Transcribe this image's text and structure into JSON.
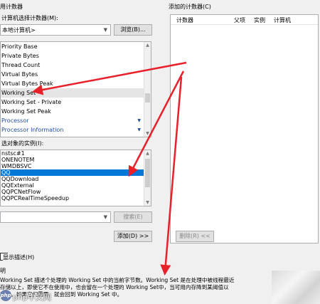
{
  "header": {
    "available_counters": "用计数器",
    "select_from_computer": "计算机选择计数器(M):",
    "added_counters": "添加的计数器(C)"
  },
  "computer": {
    "value": "本地计算机>",
    "browse_label": "浏览(B)..."
  },
  "counters": {
    "items": [
      {
        "label": "Priority Base"
      },
      {
        "label": "Private Bytes"
      },
      {
        "label": "Thread Count"
      },
      {
        "label": "Virtual Bytes"
      },
      {
        "label": "Virtual Bytes Peak"
      },
      {
        "label": "Working Set"
      },
      {
        "label": "Working Set - Private"
      },
      {
        "label": "Working Set Peak"
      },
      {
        "label": "Processor"
      },
      {
        "label": "Processor Information"
      }
    ]
  },
  "instances": {
    "label": "选对象的实例(I):",
    "items": [
      {
        "label": "nstsc#1"
      },
      {
        "label": "ONENOTEM"
      },
      {
        "label": "WMDBSVC"
      },
      {
        "label": "QQ"
      },
      {
        "label": "QQDownload"
      },
      {
        "label": "QQExternal"
      },
      {
        "label": "QQPCNetFlow"
      },
      {
        "label": "QQPCRealTimeSpeedup"
      }
    ]
  },
  "search": {
    "value": "",
    "button_label": "搜索(E)"
  },
  "add_button_label": "添加(D) >>",
  "added_table": {
    "columns": [
      "计数器",
      "父项",
      "实例",
      "计算机"
    ]
  },
  "remove_button_label": "删除(R) <<",
  "show_description_label": "显示描述(H)",
  "description": {
    "title": "明",
    "lines": [
      "Working Set 描述个处理的 Working Set 中的当前字节数。Working Set 是在处理中被线程最近",
      "存储以上，即使它不在使用中，也会留在一个处理的 Working Set中，当可用内存降到某阈值以",
      "页面。如果它们需要，就会回到 Working Set 中。"
    ]
  },
  "watermark": "php中文网",
  "colors": {
    "selection": "#0078d7",
    "annotation_arrow": "#e8202a",
    "category": "#1f4e9e"
  }
}
